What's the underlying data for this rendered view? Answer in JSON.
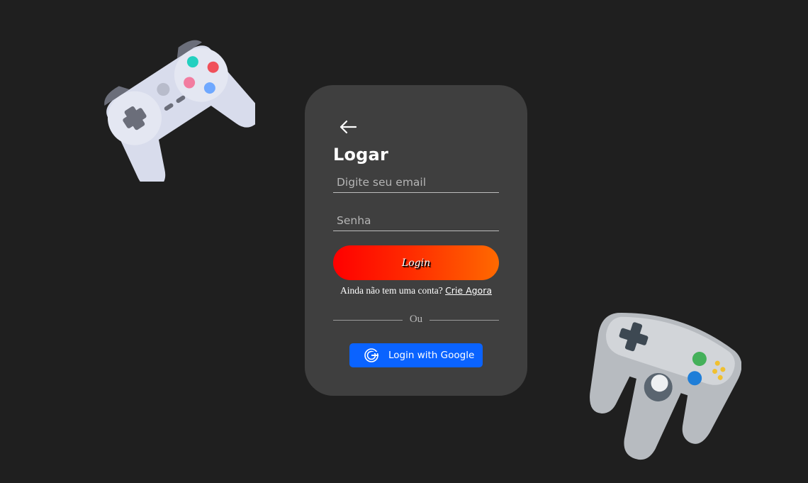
{
  "login_card": {
    "title": "Logar",
    "email_placeholder": "Digite seu email",
    "password_placeholder": "Senha",
    "login_button_label": "Login",
    "signup_prompt": "Ainda não tem uma conta?",
    "signup_link_label": "Crie Agora",
    "divider_text": "Ou",
    "google_button_label": "Login with Google"
  },
  "icons": {
    "back": "arrow-left-icon",
    "google": "google-icon",
    "decor_left": "gamepad-icon",
    "decor_right": "n64-controller-icon"
  },
  "colors": {
    "background": "#1f1f1f",
    "card": "#3f3f3f",
    "login_gradient_start": "#ff0000",
    "login_gradient_end": "#ff6a00",
    "google_button": "#0a63ff"
  }
}
